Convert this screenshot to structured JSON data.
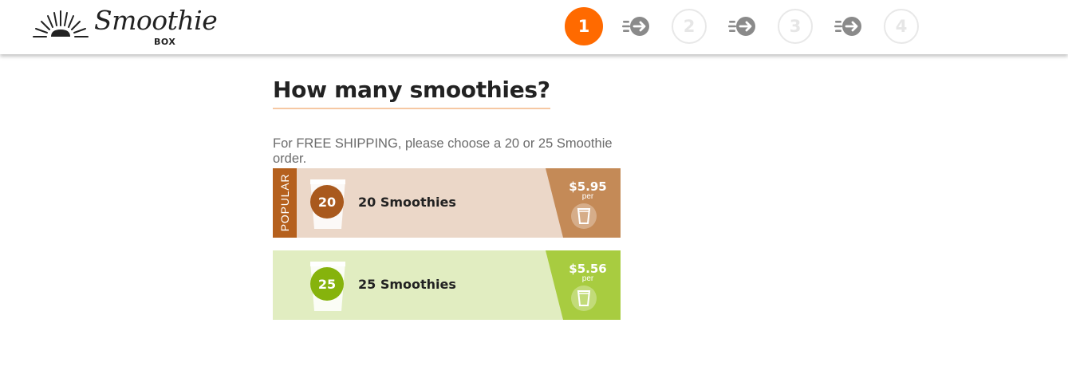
{
  "logo": {
    "script": "Smoothie",
    "sub": "BOX"
  },
  "steps": [
    "1",
    "2",
    "3",
    "4"
  ],
  "main": {
    "title": "How many smoothies?",
    "subtitle": "For FREE SHIPPING, please choose a 20 or 25 Smoothie order."
  },
  "options": [
    {
      "tag": "POPULAR",
      "count": "20",
      "label": "20 Smoothies",
      "price": "$5.95",
      "per": "per",
      "color": "#a9591d"
    },
    {
      "count": "25",
      "label": "25 Smoothies",
      "price": "$5.56",
      "per": "per",
      "color": "#86b30c"
    }
  ],
  "colors": {
    "accent": "#ff6a00"
  }
}
